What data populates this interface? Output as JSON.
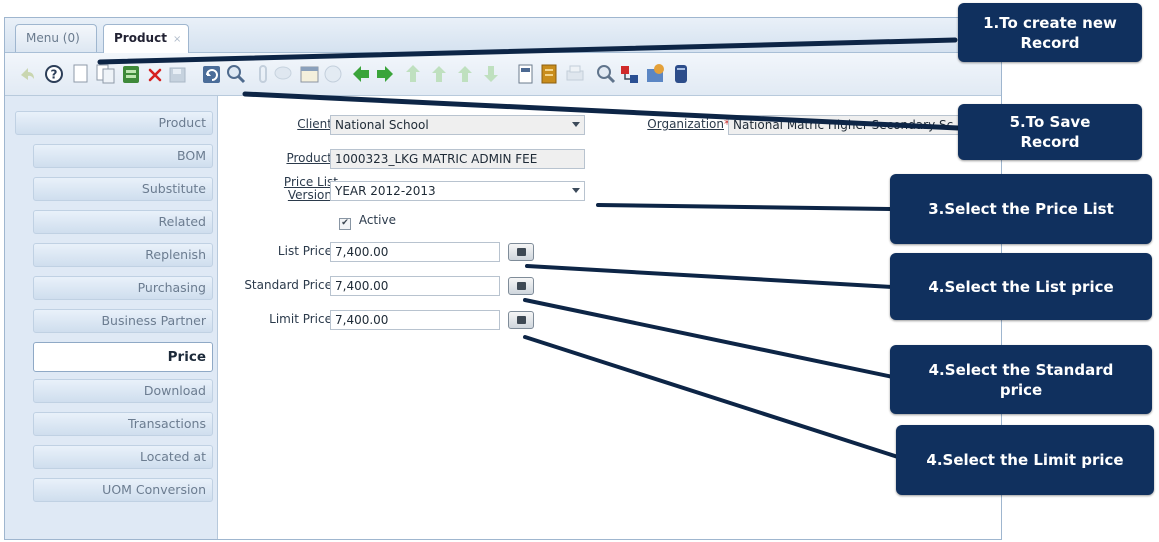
{
  "tabs": {
    "menu_label": "Menu (0)",
    "product_label": "Product",
    "close_glyph": "×"
  },
  "toolbar": {
    "icons": [
      "undo-icon",
      "help-icon",
      "new-record-icon",
      "copy-record-icon",
      "delete-selection-icon",
      "delete-icon",
      "save-icon",
      "refresh-icon",
      "find-icon",
      "attachment-icon",
      "chat-icon",
      "history-icon",
      "check-icon",
      "first-record-icon",
      "previous-record-icon",
      "next-record-icon",
      "last-record-icon",
      "detail-icon",
      "parent-icon",
      "report-icon",
      "archive-icon",
      "print-icon",
      "zoom-icon",
      "workflow-icon",
      "product-info-icon",
      "translate-icon"
    ]
  },
  "sidebar": {
    "items": [
      {
        "label": "Product"
      },
      {
        "label": "BOM"
      },
      {
        "label": "Substitute"
      },
      {
        "label": "Related"
      },
      {
        "label": "Replenish"
      },
      {
        "label": "Purchasing"
      },
      {
        "label": "Business Partner"
      },
      {
        "label": "Price"
      },
      {
        "label": "Download"
      },
      {
        "label": "Transactions"
      },
      {
        "label": "Located at"
      },
      {
        "label": "UOM Conversion"
      }
    ],
    "selected": "Price"
  },
  "form": {
    "client_label": "Client",
    "client_value": "National School",
    "organization_label": "Organization",
    "organization_value": "National Matric Higher Secondary Sc",
    "product_label": "Product",
    "product_value": "1000323_LKG MATRIC ADMIN FEE",
    "price_list_label_line1": "Price List",
    "price_list_label_line2": "Version",
    "price_list_value": "YEAR 2012-2013",
    "active_label": "Active",
    "active_checked": true,
    "list_price_label": "List Price",
    "list_price_value": "7,400.00",
    "standard_price_label": "Standard Price",
    "standard_price_value": "7,400.00",
    "limit_price_label": "Limit Price",
    "limit_price_value": "7,400.00",
    "required_mark": "*"
  },
  "callouts": [
    {
      "id": "new-record",
      "line1": "1.To create new",
      "line2": "Record"
    },
    {
      "id": "save-record",
      "line1": "5.To Save",
      "line2": "Record"
    },
    {
      "id": "price-list",
      "line1": "3.Select the Price List",
      "line2": ""
    },
    {
      "id": "list-price",
      "line1": "4.Select the List price",
      "line2": ""
    },
    {
      "id": "standard-price",
      "line1": "4.Select the Standard",
      "line2": "price"
    },
    {
      "id": "limit-price",
      "line1": "4.Select the Limit price",
      "line2": ""
    }
  ],
  "colors": {
    "callout_bg": "#10305e",
    "required": "#c83232",
    "nav_green": "#3aa43a"
  }
}
